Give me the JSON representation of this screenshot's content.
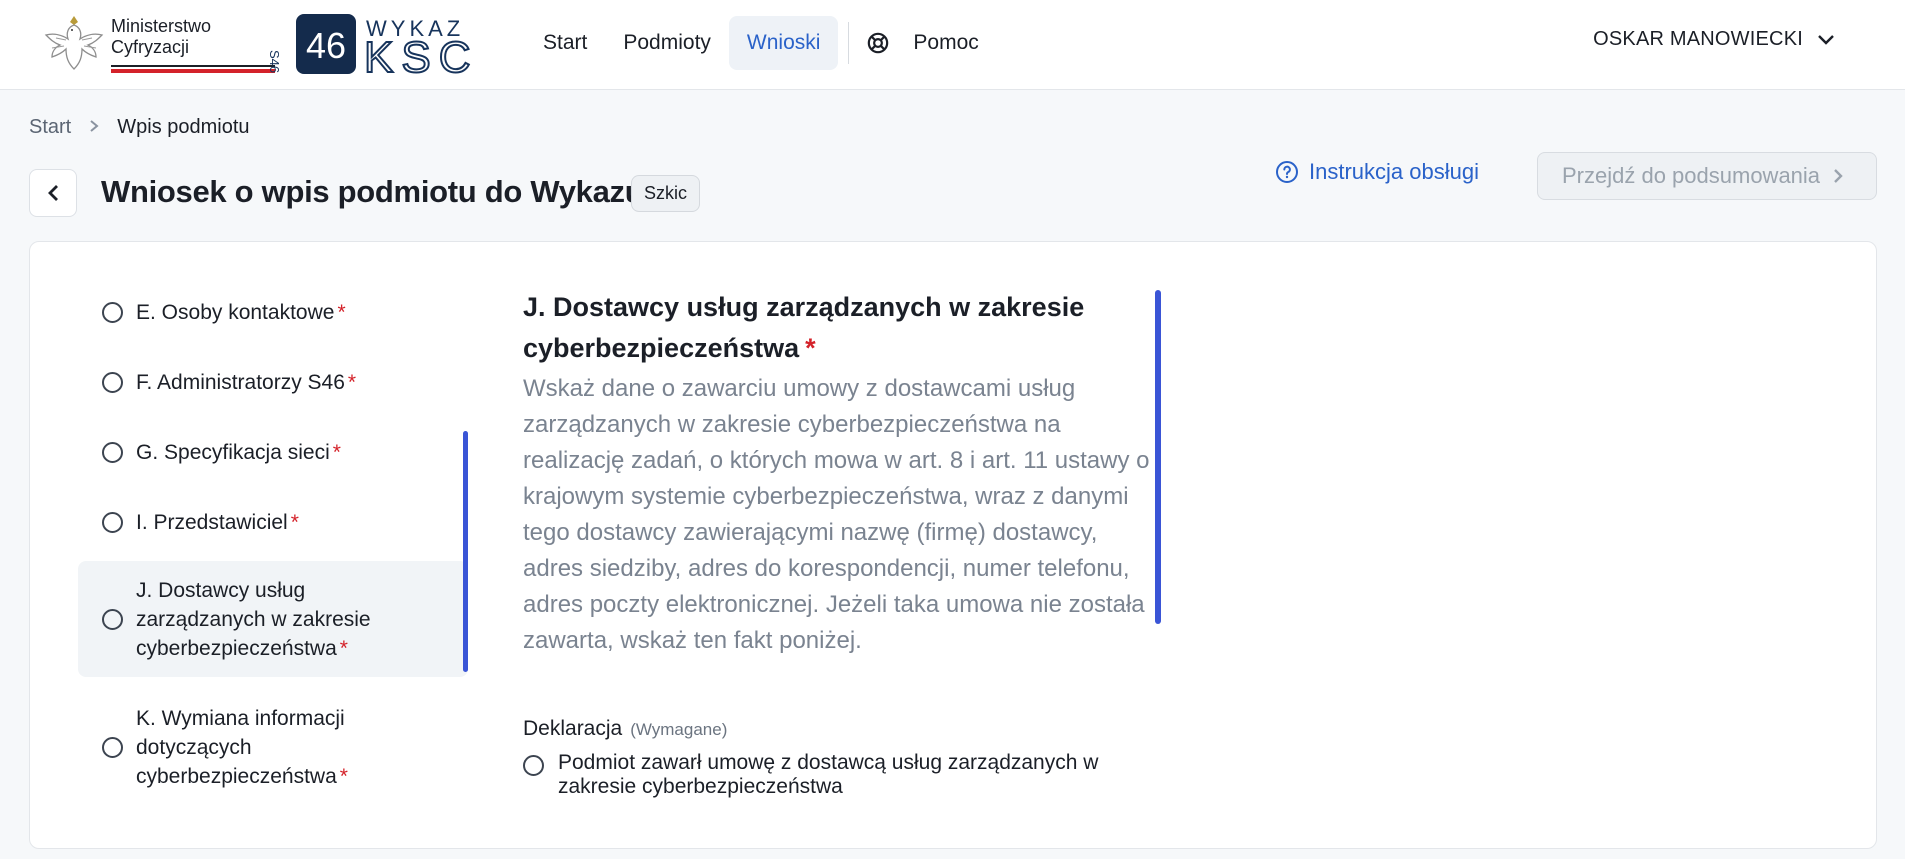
{
  "header": {
    "ministry_line1": "Ministerstwo",
    "ministry_line2": "Cyfryzacji",
    "ksc_number": "46",
    "ksc_side": "S46",
    "ksc_line1": "WYKAZ",
    "ksc_line2": "KSC",
    "nav": [
      {
        "label": "Start",
        "active": false
      },
      {
        "label": "Podmioty",
        "active": false
      },
      {
        "label": "Wnioski",
        "active": true
      }
    ],
    "help_label": "Pomoc",
    "user_name": "OSKAR MANOWIECKI"
  },
  "breadcrumb": {
    "items": [
      "Start",
      "Wpis podmiotu"
    ]
  },
  "page": {
    "title": "Wniosek o wpis podmiotu do Wykazu",
    "status_badge": "Szkic",
    "instructions_label": "Instrukcja obsługi",
    "summary_button": "Przejdź do podsumowania"
  },
  "steps": [
    {
      "label": "E. Osoby kontaktowe",
      "required": "*"
    },
    {
      "label": "F. Administratorzy S46",
      "required": "*"
    },
    {
      "label": "G. Specyfikacja sieci",
      "required": "*"
    },
    {
      "label": "I. Przedstawiciel",
      "required": "*"
    },
    {
      "label": "J. Dostawcy usług zarządzanych w zakresie cyberbezpieczeństwa",
      "required": "*",
      "active": true
    },
    {
      "label": "K. Wymiana informacji dotyczących cyberbezpieczeństwa",
      "required": "*"
    }
  ],
  "section": {
    "title": "J. Dostawcy usług zarządzanych w zakresie cyberbezpieczeństwa",
    "required": "*",
    "description": "Wskaż dane o zawarciu umowy z dostawcami usług zarządzanych w zakresie cyberbezpieczeństwa na realizację zadań, o których mowa w art. 8 i art. 11 ustawy o krajowym systemie cyberbezpieczeństwa, wraz z danymi tego dostawcy zawierającymi nazwę (firmę) dostawcy, adres siedziby, adres do korespondencji, numer telefonu, adres poczty elektronicznej. Jeżeli taka umowa nie została zawarta, wskaż ten fakt poniżej.",
    "declaration_label": "Deklaracja",
    "declaration_hint": "(Wymagane)",
    "declaration_option": "Podmiot zawarł umowę z dostawcą usług zarządzanych w zakresie cyberbezpieczeństwa"
  },
  "colors": {
    "accent": "#2a62c9",
    "required": "#d4222a",
    "scroll_indicator": "#3a55d6"
  }
}
